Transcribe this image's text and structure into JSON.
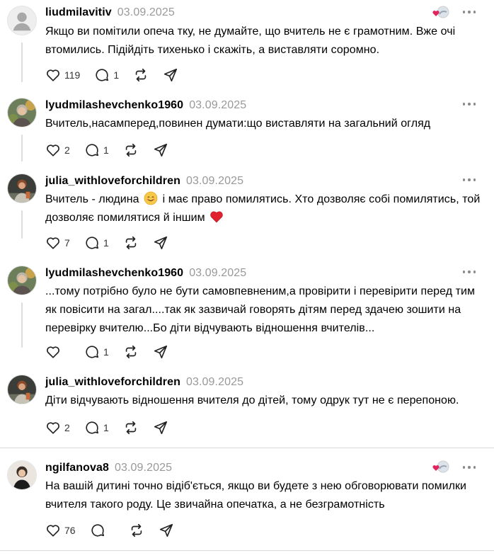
{
  "comments": [
    {
      "username": "liudmilavitiv",
      "date": "03.09.2025",
      "text": "Якщо ви помітили опеча тку, не думайте, що вчитель не є грамотним. Вже очі втомились. Підійдіть тихенько і скажіть, а виставляти соромно.",
      "likes": "119",
      "replies": "1",
      "avatar": "default-avatar-icon",
      "author_liked": true
    },
    {
      "username": "lyudmilashevchenko1960",
      "date": "03.09.2025",
      "text": "Вчитель,насамперед,повинен думати:що виставляти на загальний огляд",
      "likes": "2",
      "replies": "1",
      "avatar": "photo-avatar"
    },
    {
      "username": "julia_withloveforchildren",
      "date": "03.09.2025",
      "text_part1": "Вчитель - людина",
      "text_part2": "і має право помилятись. Хто дозволяє собі помилятись, той дозволяє помилятися й іншим",
      "emoji1": "smiling-face-emoji",
      "emoji2": "red-heart-emoji",
      "likes": "7",
      "replies": "1",
      "avatar": "photo-avatar"
    },
    {
      "username": "lyudmilashevchenko1960",
      "date": "03.09.2025",
      "text": "...тому потрібно було не бути самовпевненим,а провірити і перевірити перед тим як повісити на загал....так як зазвичай говорять дітям перед здачею зошити на перевірку вчителю...Бо діти відчувають відношення вчителів...",
      "likes": "",
      "replies": "1",
      "avatar": "photo-avatar"
    },
    {
      "username": "julia_withloveforchildren",
      "date": "03.09.2025",
      "text": "Діти відчувають відношення вчителя до дітей, тому одрук тут не є перепоною.",
      "likes": "2",
      "replies": "1",
      "avatar": "photo-avatar"
    },
    {
      "username": "ngilfanova8",
      "date": "03.09.2025",
      "text": "На вашій дитині точно відіб'ється, якщо ви будете з нею обговорювати помилки вчителя такого роду. Це звичайна опечатка, а не безграмотність",
      "likes": "76",
      "replies": "",
      "avatar": "photo-avatar",
      "author_liked": true
    }
  ],
  "colors": {
    "date": "#999999",
    "heart_badge": "#e0245e",
    "thread_line": "#dcdcdc",
    "divider": "#d9d9d9"
  }
}
